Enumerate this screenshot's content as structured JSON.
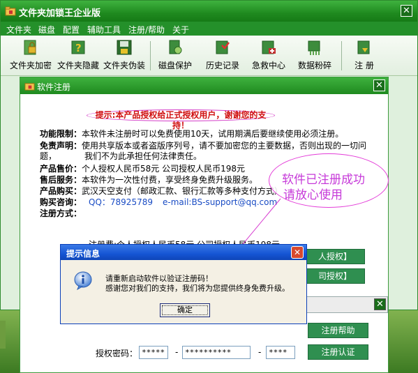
{
  "window": {
    "title": "文件夹加锁王企业版",
    "close": "✕"
  },
  "menu": [
    "文件夹",
    "磁盘",
    "配置",
    "辅助工具",
    "注册/帮助",
    "关于"
  ],
  "toolbar": [
    {
      "label": "文件夹加密",
      "icon": "folder-encrypt-icon"
    },
    {
      "label": "文件夹隐藏",
      "icon": "folder-hide-icon"
    },
    {
      "label": "文件夹伪装",
      "icon": "folder-disguise-icon"
    },
    {
      "label": "磁盘保护",
      "icon": "disk-protect-icon"
    },
    {
      "label": "历史记录",
      "icon": "history-icon"
    },
    {
      "label": "急救中心",
      "icon": "first-aid-icon"
    },
    {
      "label": "数据粉碎",
      "icon": "data-shred-icon"
    },
    {
      "label": "注 册",
      "icon": "register-icon"
    }
  ],
  "register_dialog": {
    "title": "软件注册",
    "close": "✕",
    "banner": "提示:本产品授权给正式授权用户，谢谢您的支持！",
    "rows": [
      {
        "label": "功能限制：",
        "text": "本软件未注册时可以免费使用10天，试用期满后要继续使用必须注册。"
      },
      {
        "label": "免责声明：",
        "text": "使用共享版本或者盗版序列号，请不要加密您的主要数据，否则出现的一切问题，"
      },
      {
        "label": "",
        "text": "我们不为此承担任何法律责任。"
      },
      {
        "label": "产品售价：",
        "text": "个人授权人民币58元  公司授权人民币198元"
      },
      {
        "label": "售后服务：",
        "text": "本软件为一次性付费，享受终身免费升级服务。"
      },
      {
        "label": "产品购买：",
        "text": "武汉天空支付（邮政汇款、银行汇款等多种支付方式）"
      },
      {
        "label": "购买咨询：",
        "qq": "QQ：78925789",
        "email": "e-mail:BS-support@qq.com"
      },
      {
        "label": "注册方式：",
        "text": ""
      }
    ],
    "fee_line": "注册费:个人授权人民币58元  公司授权人民币198元",
    "buy_personal": "人授权】",
    "buy_company": "司授权】",
    "register_help": "注册帮助",
    "register_auth": "注册认证",
    "auth_code_label": "授权密码：",
    "auth_code": [
      "*****",
      "**********",
      "****"
    ],
    "sub_close": "✕"
  },
  "annotation": {
    "line1": "软件已注册成功",
    "line2": "请放心使用"
  },
  "message_box": {
    "title": "提示信息",
    "close": "✕",
    "line1": "请重新启动软件以验证注册码！",
    "line2": "感谢您对我们的支持，我们将为您提供终身免费升级。",
    "ok": "确定"
  },
  "colors": {
    "title_green": "#1f8a1f",
    "banner_red": "#d01010",
    "annotation_magenta": "#c63ad9",
    "msgbox_blue": "#1555d4"
  }
}
